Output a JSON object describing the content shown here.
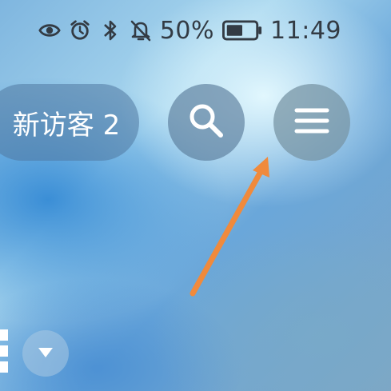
{
  "status_bar": {
    "battery_percent": "50%",
    "time": "11:49",
    "icons": [
      "eye-icon",
      "alarm-icon",
      "bluetooth-icon",
      "bell-off-icon",
      "battery-icon"
    ]
  },
  "visitor_pill": {
    "label": "新访客 2"
  },
  "toolbar": {
    "search_icon": "search-icon",
    "menu_icon": "menu-icon"
  },
  "annotation": {
    "arrow_color": "#f08a3c"
  },
  "colors": {
    "status_text": "#333b44",
    "button_fg": "#ffffff"
  }
}
